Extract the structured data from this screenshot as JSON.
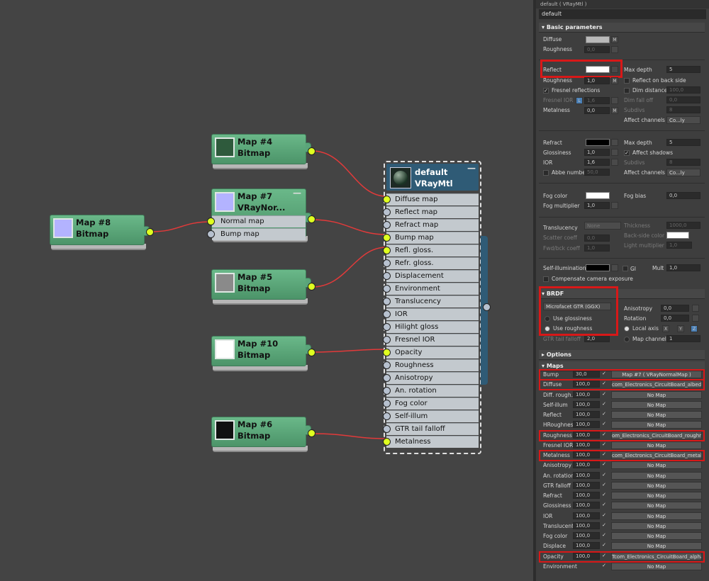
{
  "colors": {
    "canvas": "#444444",
    "node_green": "#5aa57a",
    "material_header": "#2f5b76",
    "wire": "#e23a3a",
    "socket_yellow": "#dfff20",
    "highlight": "#d81818"
  },
  "nodes": {
    "map4": {
      "name": "Map #4",
      "type": "Bitmap"
    },
    "map7": {
      "name": "Map #7",
      "type": "VRayNor...",
      "slots": [
        "Normal map",
        "Bump map"
      ]
    },
    "map8": {
      "name": "Map #8",
      "type": "Bitmap"
    },
    "map5": {
      "name": "Map #5",
      "type": "Bitmap"
    },
    "map10": {
      "name": "Map #10",
      "type": "Bitmap"
    },
    "map6": {
      "name": "Map #6",
      "type": "Bitmap"
    }
  },
  "material": {
    "name": "default",
    "type": "VRayMtl",
    "slots": [
      "Diffuse map",
      "Reflect map",
      "Refract map",
      "Bump map",
      "Refl. gloss.",
      "Refr. gloss.",
      "Displacement",
      "Environment",
      "Translucency",
      "IOR",
      "Hilight gloss",
      "Fresnel IOR",
      "Opacity",
      "Roughness",
      "Anisotropy",
      "An. rotation",
      "Fog color",
      "Self-illum",
      "GTR tail falloff",
      "Metalness"
    ]
  },
  "panel": {
    "title": "default  ( VRayMtl )",
    "name_field": "default",
    "basic": {
      "header": "Basic parameters",
      "diffuse": "Diffuse",
      "m": "M",
      "roughness": "Roughness",
      "roughness_val": "0,0",
      "reflect": "Reflect",
      "max_depth": "Max depth",
      "max_depth_val": "5",
      "reflect_back": "Reflect on back side",
      "gloss": "Roughness",
      "gloss_val": "1,0",
      "fresnel": "Fresnel reflections",
      "dim_distance": "Dim distance",
      "dim_distance_val": "100,0",
      "fresnel_ior": "Fresnel IOR",
      "l": "L",
      "fresnel_ior_val": "1,6",
      "dim_falloff": "Dim fall off",
      "dim_falloff_val": "0,0",
      "metalness": "Metalness",
      "metalness_val": "0,0",
      "subdivs": "Subdivs",
      "subdivs_val": "8",
      "affect_channels": "Affect channels",
      "color_only": "Co...ly",
      "refract": "Refract",
      "max_depth2": "Max depth",
      "max_depth2_val": "5",
      "glossiness": "Glossiness",
      "glossiness_val": "1,0",
      "affect_shadows": "Affect shadows",
      "ior": "IOR",
      "ior_val": "1,6",
      "subdivs2": "Subdivs",
      "subdivs2_val": "8",
      "abbe": "Abbe number",
      "abbe_val": "50,0",
      "affect_channels2": "Affect channels",
      "color_only2": "Co...ly",
      "fog_color": "Fog color",
      "fog_bias": "Fog bias",
      "fog_bias_val": "0,0",
      "fog_mult": "Fog multiplier",
      "fog_mult_val": "1,0",
      "translucency": "Translucency",
      "translucency_val": "None",
      "thickness": "Thickness",
      "thickness_val": "1000,0",
      "scatter": "Scatter coeff",
      "scatter_val": "0,0",
      "backside": "Back-side color",
      "fwdbck": "Fwd/bck coeff",
      "fwdbck_val": "1,0",
      "light_mult": "Light multiplier",
      "light_mult_val": "1,0",
      "selfillum": "Self-illumination",
      "gi": "GI",
      "mult": "Mult",
      "mult_val": "1,0",
      "comp_cam": "Compensate camera exposure"
    },
    "brdf": {
      "header": "BRDF",
      "type": "Microfacet GTR (GGX)",
      "use_gloss": "Use glossiness",
      "use_rough": "Use roughness",
      "aniso": "Anisotropy",
      "aniso_val": "0,0",
      "rotation": "Rotation",
      "rotation_val": "0,0",
      "local_axis": "Local axis",
      "x": "X",
      "y": "Y",
      "z": "Z",
      "map_channel": "Map channel",
      "map_channel_val": "1",
      "gtr": "GTR tail falloff",
      "gtr_val": "2,0"
    },
    "options": {
      "header": "Options"
    },
    "maps": {
      "header": "Maps",
      "rows": [
        {
          "label": "Bump",
          "amount": "30,0",
          "map": "Map #7  ( VRayNormalMap )"
        },
        {
          "label": "Diffuse",
          "amount": "100,0",
          "map": "com_Electronics_CircuitBoard_albedo"
        },
        {
          "label": "Diff. rough.",
          "amount": "100,0",
          "map": "No Map"
        },
        {
          "label": "Self-illum",
          "amount": "100,0",
          "map": "No Map"
        },
        {
          "label": "Reflect",
          "amount": "100,0",
          "map": "No Map"
        },
        {
          "label": "HRoughness",
          "amount": "100,0",
          "map": "No Map"
        },
        {
          "label": "Roughness",
          "amount": "100,0",
          "map": "om_Electronics_CircuitBoard_roughne"
        },
        {
          "label": "Fresnel IOR",
          "amount": "100,0",
          "map": "No Map"
        },
        {
          "label": "Metalness",
          "amount": "100,0",
          "map": "com_Electronics_CircuitBoard_metalne"
        },
        {
          "label": "Anisotropy",
          "amount": "100,0",
          "map": "No Map"
        },
        {
          "label": "An. rotation",
          "amount": "100,0",
          "map": "No Map"
        },
        {
          "label": "GTR falloff",
          "amount": "100,0",
          "map": "No Map"
        },
        {
          "label": "Refract",
          "amount": "100,0",
          "map": "No Map"
        },
        {
          "label": "Glossiness",
          "amount": "100,0",
          "map": "No Map"
        },
        {
          "label": "IOR",
          "amount": "100,0",
          "map": "No Map"
        },
        {
          "label": "Translucent",
          "amount": "100,0",
          "map": "No Map"
        },
        {
          "label": "Fog color",
          "amount": "100,0",
          "map": "No Map"
        },
        {
          "label": "Displace",
          "amount": "100,0",
          "map": "No Map"
        },
        {
          "label": "Opacity",
          "amount": "100,0",
          "map": "Tcom_Electronics_CircuitBoard_alpha"
        },
        {
          "label": "Environment",
          "amount": "",
          "map": "No Map"
        }
      ]
    }
  }
}
